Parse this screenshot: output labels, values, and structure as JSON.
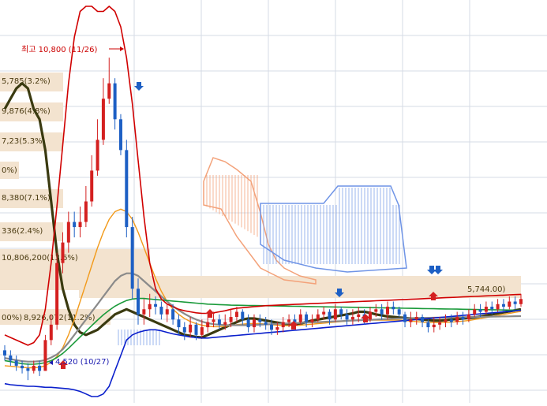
{
  "colors": {
    "up_candle": "#d42020",
    "down_candle": "#1d5fc4",
    "ma_thick": "#3a3a10",
    "ma_orange": "#f29a1a",
    "ma_green": "#1a9a3a",
    "ma_gray": "#8a8a8a",
    "ma_teal": "#2aa070",
    "bollinger_upper": "#d00000",
    "bollinger_lower": "#0a1fcc",
    "cloud_salmon": "#f3a27a",
    "cloud_blue": "#6f94e6",
    "fib_band": "#f3e3cf",
    "grid": "#d6dbe6",
    "high_label": "#cc0000",
    "low_label": "#1a1ab0"
  },
  "high_marker": {
    "text": "최고 10,800 (11/26)",
    "value": 10800,
    "date": "11/26"
  },
  "low_marker": {
    "text": "4,520 (10/27)",
    "value": 4520,
    "date": "10/27"
  },
  "fib_labels": [
    {
      "text": "5,785(3.2%)"
    },
    {
      "text": "9,876(4.8%)"
    },
    {
      "text": "7,23(5.3%)"
    },
    {
      "text": "0%)"
    },
    {
      "text": "8,380(7.1%)"
    },
    {
      "text": "336(2.4%)"
    },
    {
      "text": "10,806,200(13.6%)"
    },
    {
      "text": "00%)"
    },
    {
      "text": "8,926,072(11.2%)"
    },
    {
      "text": "5,744.00)"
    }
  ],
  "chart_data": {
    "type": "line",
    "title": "",
    "xlabel": "",
    "ylabel": "",
    "ylim": [
      4200,
      11800
    ],
    "grid": true,
    "legend": "none",
    "x": [
      1,
      2,
      3,
      4,
      5,
      6,
      7,
      8,
      9,
      10,
      11,
      12,
      13,
      14,
      15,
      16,
      17,
      18,
      19,
      20,
      21,
      22,
      23,
      24,
      25,
      26,
      27,
      28,
      29,
      30,
      31,
      32,
      33,
      34,
      35,
      36,
      37,
      38,
      39,
      40,
      41,
      42,
      43,
      44,
      45,
      46,
      47,
      48,
      49,
      50,
      51,
      52,
      53,
      54,
      55,
      56,
      57,
      58,
      59,
      60,
      61,
      62,
      63,
      64,
      65,
      66,
      67,
      68,
      69,
      70,
      71,
      72,
      73,
      74,
      75,
      76,
      77,
      78,
      79,
      80,
      81,
      82,
      83,
      84,
      85,
      86,
      87,
      88,
      89,
      90
    ],
    "candles": {
      "open": [
        5100,
        5000,
        4900,
        4800,
        4750,
        4700,
        4800,
        4700,
        5300,
        5600,
        6800,
        7200,
        7600,
        7500,
        7600,
        8000,
        8600,
        9200,
        10000,
        10300,
        9600,
        9000,
        7500,
        6300,
        5800,
        5900,
        6000,
        5950,
        5800,
        5900,
        5700,
        5550,
        5450,
        5600,
        5400,
        5550,
        5650,
        5700,
        5600,
        5650,
        5750,
        5850,
        5700,
        5550,
        5700,
        5650,
        5600,
        5500,
        5550,
        5650,
        5700,
        5650,
        5800,
        5650,
        5700,
        5800,
        5850,
        5700,
        5900,
        5800,
        5700,
        5750,
        5800,
        5700,
        5850,
        5900,
        5800,
        5950,
        5900,
        5800,
        5650,
        5700,
        5750,
        5650,
        5550,
        5600,
        5650,
        5700,
        5650,
        5750,
        5700,
        5800,
        5900,
        5850,
        5950,
        5900,
        6000,
        5950,
        6050,
        6000
      ],
      "close": [
        5000,
        4900,
        4800,
        4750,
        4700,
        4800,
        4700,
        5300,
        5600,
        6800,
        7200,
        7600,
        7500,
        7600,
        8000,
        8600,
        9200,
        10000,
        10300,
        9600,
        9000,
        7500,
        6300,
        5800,
        5900,
        6000,
        5950,
        5800,
        5900,
        5700,
        5550,
        5450,
        5600,
        5400,
        5550,
        5650,
        5700,
        5600,
        5650,
        5750,
        5850,
        5700,
        5550,
        5700,
        5650,
        5600,
        5500,
        5550,
        5650,
        5700,
        5650,
        5800,
        5650,
        5700,
        5800,
        5850,
        5700,
        5900,
        5800,
        5700,
        5750,
        5800,
        5700,
        5850,
        5900,
        5800,
        5950,
        5900,
        5800,
        5650,
        5700,
        5750,
        5650,
        5550,
        5600,
        5650,
        5700,
        5650,
        5750,
        5700,
        5800,
        5900,
        5850,
        5950,
        5900,
        6000,
        5950,
        6050,
        6000,
        6100
      ],
      "high": [
        5200,
        5100,
        5000,
        4900,
        4850,
        4900,
        4900,
        5400,
        5800,
        7000,
        7400,
        7800,
        7800,
        7900,
        8300,
        8900,
        9600,
        10400,
        10800,
        10400,
        9700,
        9200,
        7700,
        6500,
        6100,
        6200,
        6150,
        6050,
        6000,
        6000,
        5800,
        5650,
        5750,
        5650,
        5700,
        5800,
        5850,
        5800,
        5800,
        5900,
        5950,
        5900,
        5800,
        5800,
        5800,
        5750,
        5700,
        5650,
        5750,
        5800,
        5800,
        5900,
        5850,
        5800,
        5900,
        5950,
        5900,
        6000,
        5950,
        5900,
        5900,
        5950,
        5900,
        5950,
        6000,
        6000,
        6050,
        6050,
        5950,
        5850,
        5850,
        5850,
        5800,
        5700,
        5750,
        5750,
        5800,
        5800,
        5850,
        5850,
        5900,
        6000,
        6000,
        6050,
        6050,
        6100,
        6100,
        6150,
        6150,
        6200
      ],
      "low": [
        4900,
        4800,
        4700,
        4650,
        4520,
        4650,
        4600,
        4700,
        5200,
        5500,
        6600,
        7000,
        7300,
        7300,
        7500,
        7900,
        8500,
        9100,
        9900,
        9400,
        8900,
        7300,
        6100,
        5600,
        5600,
        5750,
        5800,
        5700,
        5650,
        5600,
        5400,
        5300,
        5350,
        5300,
        5350,
        5450,
        5550,
        5500,
        5500,
        5550,
        5650,
        5600,
        5450,
        5450,
        5550,
        5500,
        5400,
        5400,
        5450,
        5550,
        5550,
        5600,
        5550,
        5550,
        5650,
        5700,
        5600,
        5650,
        5700,
        5600,
        5600,
        5650,
        5600,
        5650,
        5750,
        5700,
        5700,
        5800,
        5750,
        5550,
        5550,
        5600,
        5550,
        5450,
        5450,
        5500,
        5550,
        5550,
        5600,
        5600,
        5650,
        5750,
        5750,
        5800,
        5800,
        5850,
        5850,
        5900,
        5900,
        5950
      ]
    },
    "series": [
      {
        "key": "ma_thick",
        "values": [
          9800,
          10000,
          10200,
          10300,
          10200,
          9800,
          9600,
          9000,
          8000,
          7000,
          6300,
          5900,
          5600,
          5450,
          5400,
          5450,
          5500,
          5600,
          5700,
          5800,
          5850,
          5900,
          5850,
          5800,
          5750,
          5700,
          5650,
          5600,
          5550,
          5500,
          5450,
          5400,
          5380,
          5360,
          5350,
          5400,
          5450,
          5500,
          5550,
          5600,
          5650,
          5700,
          5720,
          5720,
          5700,
          5680,
          5660,
          5640,
          5620,
          5600,
          5600,
          5620,
          5650,
          5680,
          5700,
          5720,
          5740,
          5760,
          5780,
          5800,
          5820,
          5850,
          5850,
          5830,
          5800,
          5780,
          5760,
          5750,
          5740,
          5730,
          5720,
          5710,
          5700,
          5690,
          5680,
          5680,
          5690,
          5700,
          5710,
          5720,
          5730,
          5740,
          5760,
          5780,
          5800,
          5820,
          5840,
          5860,
          5880,
          5900
        ]
      },
      {
        "key": "ma_orange",
        "values": [
          4800,
          4790,
          4780,
          4770,
          4760,
          4760,
          4770,
          4800,
          4870,
          4980,
          5150,
          5400,
          5700,
          6050,
          6400,
          6750,
          7100,
          7400,
          7650,
          7800,
          7850,
          7800,
          7650,
          7400,
          7100,
          6800,
          6500,
          6250,
          6050,
          5900,
          5800,
          5720,
          5660,
          5620,
          5590,
          5570,
          5560,
          5560,
          5570,
          5580,
          5600,
          5610,
          5620,
          5620,
          5620,
          5610,
          5600,
          5590,
          5580,
          5580,
          5580,
          5590,
          5600,
          5610,
          5620,
          5630,
          5640,
          5650,
          5660,
          5670,
          5680,
          5690,
          5690,
          5690,
          5690,
          5690,
          5690,
          5690,
          5690,
          5680,
          5670,
          5660,
          5650,
          5640,
          5640,
          5640,
          5645,
          5650,
          5660,
          5670,
          5680,
          5700,
          5720,
          5740,
          5760,
          5780,
          5800,
          5820,
          5840,
          5860
        ]
      },
      {
        "key": "ma_gray",
        "values": [
          4950,
          4930,
          4910,
          4890,
          4880,
          4880,
          4890,
          4910,
          4960,
          5020,
          5120,
          5250,
          5400,
          5550,
          5700,
          5850,
          6000,
          6150,
          6300,
          6450,
          6550,
          6600,
          6600,
          6550,
          6450,
          6350,
          6250,
          6150,
          6050,
          5960,
          5880,
          5810,
          5750,
          5700,
          5660,
          5630,
          5610,
          5600,
          5590,
          5590,
          5590,
          5590,
          5590,
          5595,
          5600,
          5605,
          5610,
          5615,
          5620,
          5625,
          5630,
          5635,
          5640,
          5645,
          5650,
          5655,
          5660,
          5665,
          5670,
          5675,
          5680,
          5685,
          5690,
          5695,
          5700,
          5705,
          5710,
          5715,
          5720,
          5725,
          5728,
          5730,
          5732,
          5734,
          5736,
          5738,
          5740,
          5742,
          5744,
          5746,
          5748,
          5750,
          5752,
          5754,
          5756,
          5758,
          5760,
          5762,
          5764,
          5766
        ]
      },
      {
        "key": "ma_green",
        "values": [
          4900,
          4880,
          4860,
          4840,
          4830,
          4830,
          4840,
          4860,
          4900,
          4960,
          5040,
          5140,
          5250,
          5360,
          5470,
          5580,
          5690,
          5790,
          5880,
          5960,
          6020,
          6070,
          6100,
          6110,
          6110,
          6100,
          6090,
          6080,
          6070,
          6060,
          6050,
          6040,
          6030,
          6020,
          6010,
          6000,
          5995,
          5990,
          5985,
          5980,
          5978,
          5976,
          5974,
          5972,
          5970,
          5968,
          5966,
          5964,
          5962,
          5960,
          5958,
          5956,
          5954,
          5952,
          5950,
          5948,
          5946,
          5944,
          5942,
          5940,
          5938,
          5936,
          5934,
          5932,
          5930,
          5928,
          5926,
          5924,
          5922,
          5920,
          5918,
          5916,
          5914,
          5912,
          5910,
          5908,
          5906,
          5904,
          5902,
          5900,
          5898,
          5896,
          5894,
          5892,
          5890,
          5888,
          5886,
          5884,
          5882,
          5880
        ]
      },
      {
        "key": "bollinger_upper",
        "values": [
          5400,
          5350,
          5300,
          5250,
          5200,
          5250,
          5400,
          5900,
          6800,
          7900,
          9100,
          10300,
          11200,
          11700,
          11800,
          11800,
          11700,
          11700,
          11800,
          11700,
          11400,
          10800,
          9900,
          8800,
          7700,
          6800,
          6300,
          6100,
          6000,
          5950,
          5900,
          5870,
          5850,
          5830,
          5820,
          5820,
          5830,
          5850,
          5870,
          5900,
          5920,
          5930,
          5940,
          5950,
          5960,
          5970,
          5975,
          5980,
          5985,
          5990,
          5995,
          6000,
          6005,
          6010,
          6015,
          6020,
          6025,
          6030,
          6035,
          6040,
          6045,
          6050,
          6055,
          6060,
          6065,
          6070,
          6075,
          6080,
          6085,
          6090,
          6095,
          6100,
          6105,
          6110,
          6115,
          6120,
          6125,
          6130,
          6135,
          6140,
          6145,
          6150,
          6155,
          6160,
          6165,
          6170,
          6175,
          6180,
          6185,
          6190
        ]
      },
      {
        "key": "bollinger_lower",
        "values": [
          4450,
          4430,
          4420,
          4410,
          4400,
          4400,
          4390,
          4380,
          4380,
          4370,
          4360,
          4350,
          4330,
          4300,
          4250,
          4200,
          4200,
          4250,
          4400,
          4700,
          5000,
          5300,
          5400,
          5450,
          5480,
          5500,
          5500,
          5480,
          5450,
          5420,
          5400,
          5380,
          5360,
          5350,
          5340,
          5340,
          5350,
          5360,
          5370,
          5380,
          5390,
          5400,
          5410,
          5420,
          5430,
          5440,
          5450,
          5460,
          5470,
          5480,
          5490,
          5500,
          5510,
          5520,
          5530,
          5540,
          5550,
          5560,
          5570,
          5580,
          5590,
          5600,
          5610,
          5620,
          5630,
          5640,
          5650,
          5660,
          5670,
          5680,
          5690,
          5700,
          5710,
          5720,
          5730,
          5740,
          5750,
          5760,
          5770,
          5780,
          5790,
          5800,
          5810,
          5820,
          5830,
          5840,
          5850,
          5860,
          5870,
          5880
        ]
      }
    ]
  }
}
